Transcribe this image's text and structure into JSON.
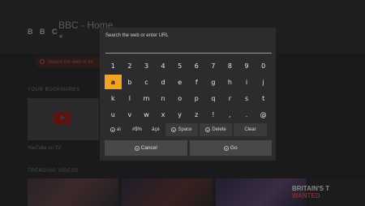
{
  "background": {
    "logo_text": "B B C",
    "page_title": "BBC - Home",
    "search_placeholder": "Search the web or en",
    "bookmarks_heading": "YOUR BOOKMARKS",
    "bookmark_label": "YouTube on TV",
    "trending_heading": "TRENDING VIDEOS",
    "thumb4_text_line1": "BRITAIN'S T",
    "thumb4_text_line2": "WANTED"
  },
  "dialog": {
    "url_prompt": "Search the web or enter URL",
    "url_value": "",
    "selected_key": "a",
    "rows": [
      [
        "1",
        "2",
        "3",
        "4",
        "5",
        "6",
        "7",
        "8",
        "9",
        "0"
      ],
      [
        "a",
        "b",
        "c",
        "d",
        "e",
        "f",
        "g",
        "h",
        "i",
        "j"
      ],
      [
        "k",
        "l",
        "m",
        "n",
        "o",
        "p",
        "q",
        "r",
        "s",
        "t"
      ],
      [
        "u",
        "v",
        "w",
        "x",
        "y",
        "z",
        "!",
        ",",
        ".",
        "@"
      ]
    ],
    "function_keys": {
      "abc": "a\\",
      "symbols": "#$%",
      "accents": "äçé",
      "space": "Space",
      "delete": "Delete",
      "clear": "Clear"
    },
    "actions": {
      "cancel": "Cancel",
      "go": "Go"
    }
  },
  "colors": {
    "selected_key": "#f0a324",
    "dialog_bg": "#2c2c2e",
    "button_bg": "#48484a"
  }
}
